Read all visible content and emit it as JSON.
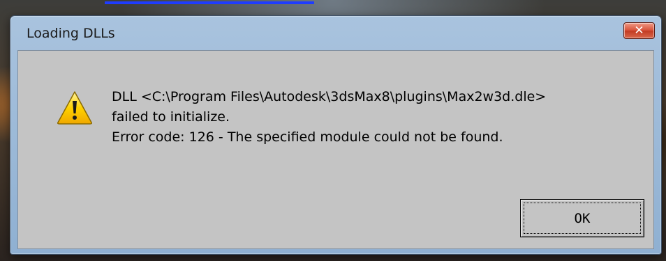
{
  "dialog": {
    "title": "Loading DLLs",
    "close_glyph": "✕",
    "icon": "warning-icon",
    "message_lines": [
      "DLL <C:\\Program Files\\Autodesk\\3dsMax8\\plugins\\Max2w3d.dle>",
      "failed to initialize.",
      "Error code: 126 - The specified module could not be found."
    ],
    "ok_label": "OK"
  },
  "colors": {
    "title_bar": "#a9c3de",
    "client_bg": "#c4c4c4",
    "close_button": "#d8533a",
    "warning_yellow": "#ffd200"
  }
}
